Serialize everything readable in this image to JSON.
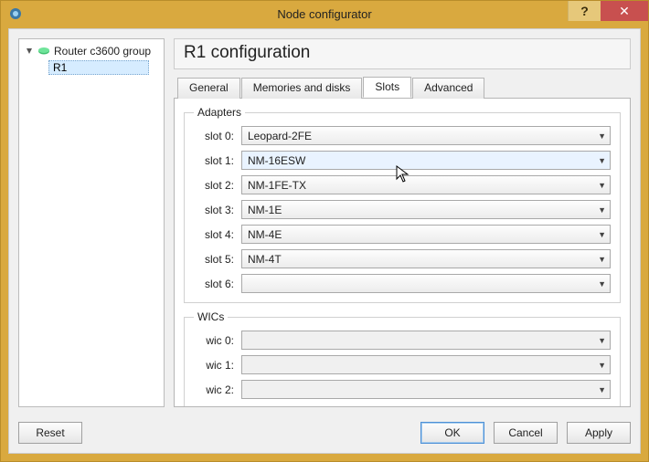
{
  "window": {
    "title": "Node configurator",
    "help_symbol": "?",
    "close_symbol": "✕"
  },
  "tree": {
    "root_label": "Router c3600 group",
    "selected_node": "R1"
  },
  "heading": "R1 configuration",
  "tabs": [
    "General",
    "Memories and disks",
    "Slots",
    "Advanced"
  ],
  "active_tab_index": 2,
  "adapters": {
    "legend": "Adapters",
    "slots": [
      {
        "label": "slot 0:",
        "value": "Leopard-2FE",
        "state": "normal"
      },
      {
        "label": "slot 1:",
        "value": "NM-16ESW",
        "state": "highlight"
      },
      {
        "label": "slot 2:",
        "value": "NM-1FE-TX",
        "state": "normal"
      },
      {
        "label": "slot 3:",
        "value": "NM-1E",
        "state": "normal"
      },
      {
        "label": "slot 4:",
        "value": "NM-4E",
        "state": "normal"
      },
      {
        "label": "slot 5:",
        "value": "NM-4T",
        "state": "normal"
      },
      {
        "label": "slot 6:",
        "value": "",
        "state": "normal"
      }
    ]
  },
  "wics": {
    "legend": "WICs",
    "slots": [
      {
        "label": "wic 0:",
        "value": "",
        "state": "disabled"
      },
      {
        "label": "wic 1:",
        "value": "",
        "state": "disabled"
      },
      {
        "label": "wic 2:",
        "value": "",
        "state": "disabled"
      }
    ]
  },
  "buttons": {
    "reset": "Reset",
    "ok": "OK",
    "cancel": "Cancel",
    "apply": "Apply"
  }
}
